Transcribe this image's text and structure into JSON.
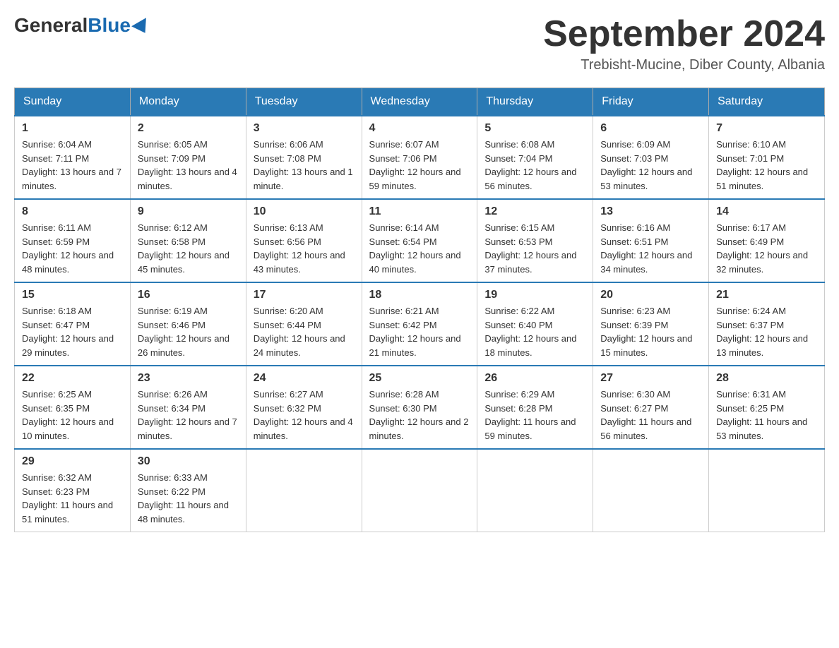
{
  "header": {
    "logo": {
      "general": "General",
      "blue": "Blue"
    },
    "title": "September 2024",
    "location": "Trebisht-Mucine, Diber County, Albania"
  },
  "calendar": {
    "headers": [
      "Sunday",
      "Monday",
      "Tuesday",
      "Wednesday",
      "Thursday",
      "Friday",
      "Saturday"
    ],
    "weeks": [
      [
        {
          "day": "1",
          "sunrise": "Sunrise: 6:04 AM",
          "sunset": "Sunset: 7:11 PM",
          "daylight": "Daylight: 13 hours and 7 minutes."
        },
        {
          "day": "2",
          "sunrise": "Sunrise: 6:05 AM",
          "sunset": "Sunset: 7:09 PM",
          "daylight": "Daylight: 13 hours and 4 minutes."
        },
        {
          "day": "3",
          "sunrise": "Sunrise: 6:06 AM",
          "sunset": "Sunset: 7:08 PM",
          "daylight": "Daylight: 13 hours and 1 minute."
        },
        {
          "day": "4",
          "sunrise": "Sunrise: 6:07 AM",
          "sunset": "Sunset: 7:06 PM",
          "daylight": "Daylight: 12 hours and 59 minutes."
        },
        {
          "day": "5",
          "sunrise": "Sunrise: 6:08 AM",
          "sunset": "Sunset: 7:04 PM",
          "daylight": "Daylight: 12 hours and 56 minutes."
        },
        {
          "day": "6",
          "sunrise": "Sunrise: 6:09 AM",
          "sunset": "Sunset: 7:03 PM",
          "daylight": "Daylight: 12 hours and 53 minutes."
        },
        {
          "day": "7",
          "sunrise": "Sunrise: 6:10 AM",
          "sunset": "Sunset: 7:01 PM",
          "daylight": "Daylight: 12 hours and 51 minutes."
        }
      ],
      [
        {
          "day": "8",
          "sunrise": "Sunrise: 6:11 AM",
          "sunset": "Sunset: 6:59 PM",
          "daylight": "Daylight: 12 hours and 48 minutes."
        },
        {
          "day": "9",
          "sunrise": "Sunrise: 6:12 AM",
          "sunset": "Sunset: 6:58 PM",
          "daylight": "Daylight: 12 hours and 45 minutes."
        },
        {
          "day": "10",
          "sunrise": "Sunrise: 6:13 AM",
          "sunset": "Sunset: 6:56 PM",
          "daylight": "Daylight: 12 hours and 43 minutes."
        },
        {
          "day": "11",
          "sunrise": "Sunrise: 6:14 AM",
          "sunset": "Sunset: 6:54 PM",
          "daylight": "Daylight: 12 hours and 40 minutes."
        },
        {
          "day": "12",
          "sunrise": "Sunrise: 6:15 AM",
          "sunset": "Sunset: 6:53 PM",
          "daylight": "Daylight: 12 hours and 37 minutes."
        },
        {
          "day": "13",
          "sunrise": "Sunrise: 6:16 AM",
          "sunset": "Sunset: 6:51 PM",
          "daylight": "Daylight: 12 hours and 34 minutes."
        },
        {
          "day": "14",
          "sunrise": "Sunrise: 6:17 AM",
          "sunset": "Sunset: 6:49 PM",
          "daylight": "Daylight: 12 hours and 32 minutes."
        }
      ],
      [
        {
          "day": "15",
          "sunrise": "Sunrise: 6:18 AM",
          "sunset": "Sunset: 6:47 PM",
          "daylight": "Daylight: 12 hours and 29 minutes."
        },
        {
          "day": "16",
          "sunrise": "Sunrise: 6:19 AM",
          "sunset": "Sunset: 6:46 PM",
          "daylight": "Daylight: 12 hours and 26 minutes."
        },
        {
          "day": "17",
          "sunrise": "Sunrise: 6:20 AM",
          "sunset": "Sunset: 6:44 PM",
          "daylight": "Daylight: 12 hours and 24 minutes."
        },
        {
          "day": "18",
          "sunrise": "Sunrise: 6:21 AM",
          "sunset": "Sunset: 6:42 PM",
          "daylight": "Daylight: 12 hours and 21 minutes."
        },
        {
          "day": "19",
          "sunrise": "Sunrise: 6:22 AM",
          "sunset": "Sunset: 6:40 PM",
          "daylight": "Daylight: 12 hours and 18 minutes."
        },
        {
          "day": "20",
          "sunrise": "Sunrise: 6:23 AM",
          "sunset": "Sunset: 6:39 PM",
          "daylight": "Daylight: 12 hours and 15 minutes."
        },
        {
          "day": "21",
          "sunrise": "Sunrise: 6:24 AM",
          "sunset": "Sunset: 6:37 PM",
          "daylight": "Daylight: 12 hours and 13 minutes."
        }
      ],
      [
        {
          "day": "22",
          "sunrise": "Sunrise: 6:25 AM",
          "sunset": "Sunset: 6:35 PM",
          "daylight": "Daylight: 12 hours and 10 minutes."
        },
        {
          "day": "23",
          "sunrise": "Sunrise: 6:26 AM",
          "sunset": "Sunset: 6:34 PM",
          "daylight": "Daylight: 12 hours and 7 minutes."
        },
        {
          "day": "24",
          "sunrise": "Sunrise: 6:27 AM",
          "sunset": "Sunset: 6:32 PM",
          "daylight": "Daylight: 12 hours and 4 minutes."
        },
        {
          "day": "25",
          "sunrise": "Sunrise: 6:28 AM",
          "sunset": "Sunset: 6:30 PM",
          "daylight": "Daylight: 12 hours and 2 minutes."
        },
        {
          "day": "26",
          "sunrise": "Sunrise: 6:29 AM",
          "sunset": "Sunset: 6:28 PM",
          "daylight": "Daylight: 11 hours and 59 minutes."
        },
        {
          "day": "27",
          "sunrise": "Sunrise: 6:30 AM",
          "sunset": "Sunset: 6:27 PM",
          "daylight": "Daylight: 11 hours and 56 minutes."
        },
        {
          "day": "28",
          "sunrise": "Sunrise: 6:31 AM",
          "sunset": "Sunset: 6:25 PM",
          "daylight": "Daylight: 11 hours and 53 minutes."
        }
      ],
      [
        {
          "day": "29",
          "sunrise": "Sunrise: 6:32 AM",
          "sunset": "Sunset: 6:23 PM",
          "daylight": "Daylight: 11 hours and 51 minutes."
        },
        {
          "day": "30",
          "sunrise": "Sunrise: 6:33 AM",
          "sunset": "Sunset: 6:22 PM",
          "daylight": "Daylight: 11 hours and 48 minutes."
        },
        null,
        null,
        null,
        null,
        null
      ]
    ]
  }
}
